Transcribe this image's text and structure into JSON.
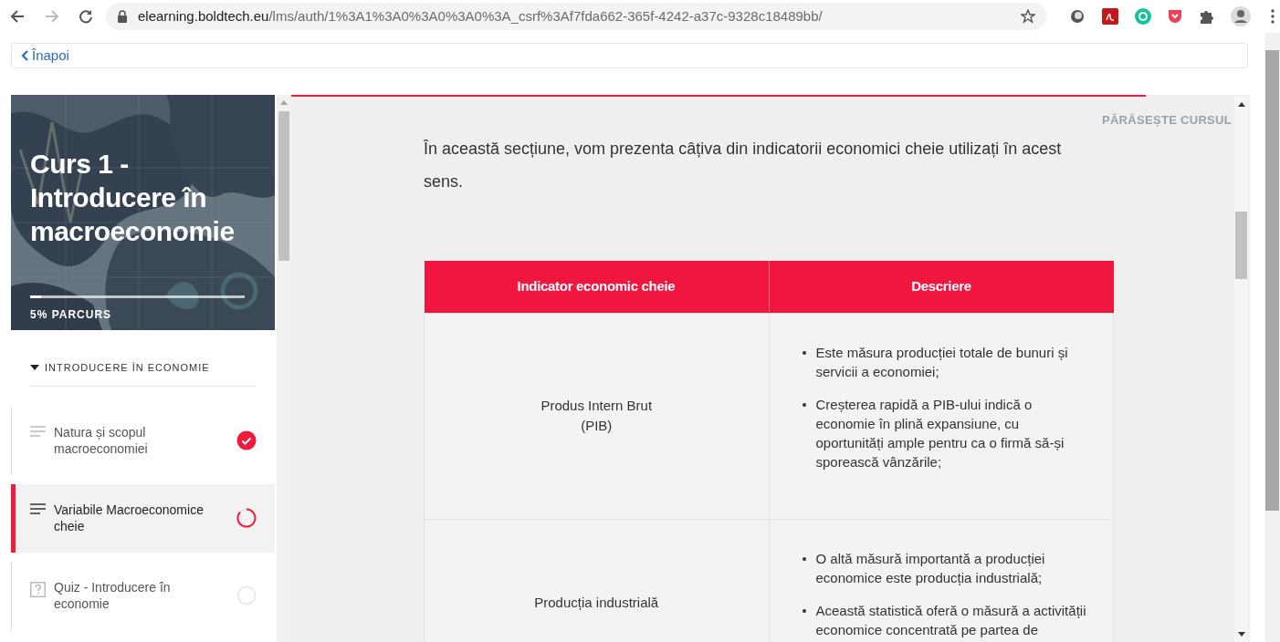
{
  "browser": {
    "url_host": "elearning.boldtech.eu",
    "url_path": "/lms/auth/1%3A1%3A0%3A0%3A0%3A_csrf%3Af7fda662-365f-4242-a37c-9328c18489bb/"
  },
  "back_link": "Înapoi",
  "course": {
    "title": "Curs 1 - Introducere în macroeconomie",
    "progress": {
      "level": 0.05,
      "label": "5% PARCURS"
    }
  },
  "section": {
    "title": "INTRODUCERE ÎN ECONOMIE",
    "expanded": true
  },
  "lessons": [
    {
      "kind": "text",
      "title": "Natura și scopul macroeconomiei",
      "completed": true,
      "in_progress": false,
      "selected": false
    },
    {
      "kind": "text",
      "title": "Variabile Macroeconomice cheie",
      "completed": false,
      "in_progress": true,
      "selected": true
    },
    {
      "kind": "quiz",
      "title": "Quiz - Introducere în economie",
      "completed": false,
      "in_progress": false,
      "selected": false
    }
  ],
  "exit_link": "PĂRĂSEȘTE CURSUL",
  "intro": "În această secțiune, vom prezenta câțiva din indicatorii economici cheie utilizați în acest sens.",
  "table": {
    "columns": [
      "Indicator economic cheie",
      "Descriere"
    ],
    "rows": [
      {
        "indicator": "Produs Intern Brut\n(PIB)",
        "description": [
          "Este măsura producției totale de bunuri și servicii a economiei;",
          "Creșterea rapidă a PIB-ului indică o economie în plină expansiune, cu oportunități ample pentru ca o firmă să-și sporească vânzările;"
        ]
      },
      {
        "indicator": "Producția industrială",
        "description": [
          "O altă măsură importantă a producției economice este producția industrială;",
          "Această statistică oferă o măsură a activității economice concentrată pe partea de"
        ]
      }
    ]
  }
}
